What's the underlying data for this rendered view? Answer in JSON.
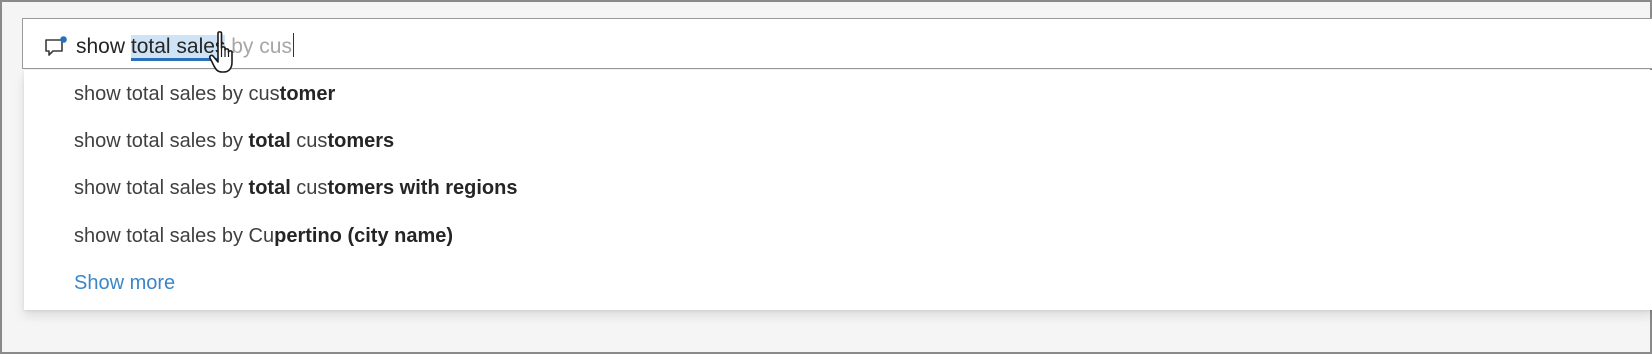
{
  "qa_input": {
    "prefix": "show ",
    "selected": "total sales",
    "ghost": " by cus",
    "icon": "chat-bubble-icon"
  },
  "suggestions": [
    {
      "parts": [
        {
          "t": "show total sales by cus",
          "b": false
        },
        {
          "t": "tomer",
          "b": true
        }
      ]
    },
    {
      "parts": [
        {
          "t": "show total sales by ",
          "b": false
        },
        {
          "t": "total",
          "b": true
        },
        {
          "t": " cus",
          "b": false
        },
        {
          "t": "tomers",
          "b": true
        }
      ]
    },
    {
      "parts": [
        {
          "t": "show total sales by ",
          "b": false
        },
        {
          "t": "total",
          "b": true
        },
        {
          "t": " cus",
          "b": false
        },
        {
          "t": "tomers with regions",
          "b": true
        }
      ]
    },
    {
      "parts": [
        {
          "t": "show total sales by Cu",
          "b": false
        },
        {
          "t": "pertino (city name)",
          "b": true
        }
      ]
    }
  ],
  "show_more": "Show more",
  "colors": {
    "accent": "#2a6fb7",
    "link": "#3a86c8",
    "selection_bg": "#cfe3f6"
  }
}
